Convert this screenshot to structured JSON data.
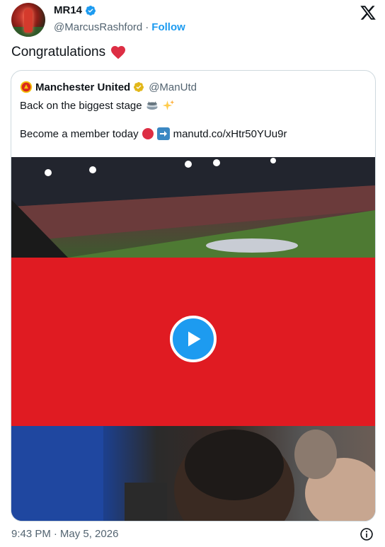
{
  "author": {
    "display_name": "MR14",
    "handle": "@MarcusRashford",
    "separator": "·",
    "follow_label": "Follow"
  },
  "tweet": {
    "text": "Congratulations",
    "emoji": "red-heart"
  },
  "quoted": {
    "name": "Manchester United",
    "handle": "@ManUtd",
    "line1": "Back on the biggest stage",
    "line1_emoji": [
      "stadium",
      "sparkles"
    ],
    "line2_prefix": "Become a member today",
    "line2_emoji": [
      "red-circle",
      "right-arrow"
    ],
    "link": "manutd.co/xHtr50YUu9r"
  },
  "media": {
    "type": "video",
    "play_icon": "play-icon"
  },
  "footer": {
    "time": "9:43 PM",
    "separator": "·",
    "date": "May 5, 2026"
  },
  "colors": {
    "accent": "#1d9bf0",
    "brand_red": "#e01b22",
    "text": "#0f1419",
    "secondary": "#536471"
  }
}
